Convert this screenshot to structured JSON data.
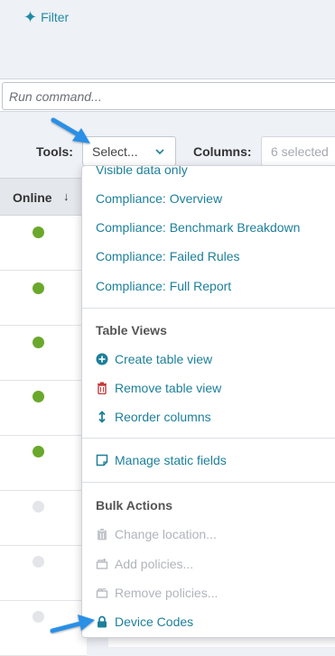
{
  "filter": {
    "label": "Filter"
  },
  "run_command": {
    "placeholder": "Run command..."
  },
  "toolbar": {
    "tools_label": "Tools:",
    "tools_value": "Select...",
    "columns_label": "Columns:",
    "columns_value": "6 selected"
  },
  "table": {
    "online_header": "Online",
    "sort_indicator": "↓",
    "rows": [
      {
        "online": true
      },
      {
        "online": true
      },
      {
        "online": true
      },
      {
        "online": true
      },
      {
        "online": true
      },
      {
        "online": false
      },
      {
        "online": false
      },
      {
        "online": false
      }
    ]
  },
  "menu": {
    "partial_top_item": "Visible data only",
    "compliance_items": [
      "Compliance: Overview",
      "Compliance: Benchmark Breakdown",
      "Compliance: Failed Rules",
      "Compliance: Full Report"
    ],
    "table_views": {
      "header": "Table Views",
      "create": "Create table view",
      "remove": "Remove table view",
      "reorder": "Reorder columns"
    },
    "manage_static": "Manage static fields",
    "bulk_actions": {
      "header": "Bulk Actions",
      "change_location": "Change location...",
      "add_policies": "Add policies...",
      "remove_policies": "Remove policies...",
      "device_codes": "Device Codes"
    }
  },
  "colors": {
    "accent": "#1d7f9a",
    "online": "#6aa82c",
    "arrow": "#2b8fe6",
    "disabled": "#b0b5bb"
  },
  "icons": {
    "filter": "sparkle-icon",
    "tools_chevron": "chevron-down-icon",
    "create": "plus-circle-icon",
    "remove": "trash-icon",
    "reorder": "up-down-arrow-icon",
    "manage": "note-icon",
    "change_location": "clipboard-icon",
    "add_policies": "add-policy-icon",
    "remove_policies": "remove-policy-icon",
    "device_codes": "lock-icon"
  }
}
